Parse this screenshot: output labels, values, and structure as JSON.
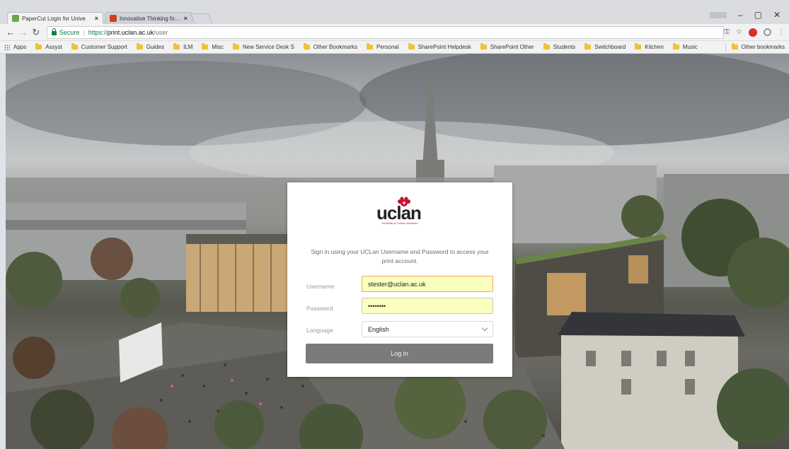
{
  "browser": {
    "tabs": [
      {
        "label": "PaperCut Login for Unive",
        "active": true
      },
      {
        "label": "Innovative Thinking for th",
        "active": false
      }
    ],
    "tab_close_glyph": "×",
    "window_badge": " ",
    "window_controls": {
      "minimize": "–",
      "maximize": "▢",
      "close": "✕"
    },
    "address": {
      "secure_label": "Secure",
      "url_scheme": "https://",
      "url_host": "print.uclan.ac.uk",
      "url_path": "/user"
    },
    "bookmarks": [
      "Apps",
      "Assyst",
      "Customer Support",
      "Guides",
      "ILM",
      "Misc",
      "New Service Desk S",
      "Other Bookmarks",
      "Personal",
      "SharePoint Helpdesk",
      "SharePoint Other",
      "Students",
      "Switchboard",
      "Kitchen",
      "Music"
    ],
    "other_bookmarks": "Other bookmarks"
  },
  "login": {
    "logo_word": "uclan",
    "logo_subtitle": "University of Central Lancashire",
    "intro": "Sign in using your UCLan Username and Password to access your print account.",
    "username_label": "Username",
    "username_value": "stester@uclan.ac.uk",
    "password_label": "Password",
    "password_value": "password",
    "language_label": "Language",
    "language_value": "English",
    "login_button": "Log in"
  },
  "colors": {
    "secure_green": "#0b8043",
    "autofill_yellow": "#faffbd",
    "button_gray": "#7b7b7b",
    "brand_red": "#c8102e",
    "bookmark_folder": "#f1c232"
  },
  "icons": [
    "papercut-favicon",
    "news-favicon",
    "back-icon",
    "forward-icon",
    "reload-icon",
    "lock-icon",
    "key-icon",
    "star-icon",
    "adblock-icon",
    "extension-icon",
    "menu-icon",
    "apps-icon",
    "folder-icon",
    "chevron-down-icon",
    "uclan-rose-icon"
  ]
}
